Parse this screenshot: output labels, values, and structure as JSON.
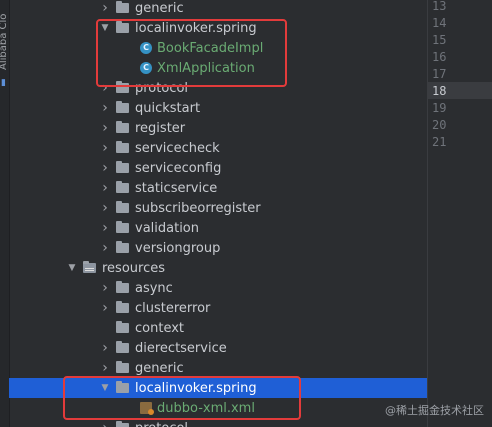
{
  "sidebar": {
    "tab_label": "Alibaba Clo",
    "icon": "pin-icon"
  },
  "gutter": {
    "lines": [
      "13",
      "14",
      "15",
      "16",
      "17",
      "18",
      "19",
      "20",
      "21"
    ],
    "current_line": "18"
  },
  "tree": {
    "rows": [
      {
        "label": "generic",
        "level": 1,
        "arrow": "collapsed",
        "type": "folder"
      },
      {
        "label": "localinvoker.spring",
        "level": 1,
        "arrow": "expanded",
        "type": "folder"
      },
      {
        "label": "BookFacadeImpl",
        "level": 2,
        "arrow": "",
        "type": "class"
      },
      {
        "label": "XmlApplication",
        "level": 2,
        "arrow": "",
        "type": "class"
      },
      {
        "label": "protocol",
        "level": 1,
        "arrow": "collapsed",
        "type": "folder"
      },
      {
        "label": "quickstart",
        "level": 1,
        "arrow": "collapsed",
        "type": "folder"
      },
      {
        "label": "register",
        "level": 1,
        "arrow": "collapsed",
        "type": "folder"
      },
      {
        "label": "servicecheck",
        "level": 1,
        "arrow": "collapsed",
        "type": "folder"
      },
      {
        "label": "serviceconfig",
        "level": 1,
        "arrow": "collapsed",
        "type": "folder"
      },
      {
        "label": "staticservice",
        "level": 1,
        "arrow": "collapsed",
        "type": "folder"
      },
      {
        "label": "subscribeorregister",
        "level": 1,
        "arrow": "collapsed",
        "type": "folder"
      },
      {
        "label": "validation",
        "level": 1,
        "arrow": "collapsed",
        "type": "folder"
      },
      {
        "label": "versiongroup",
        "level": 1,
        "arrow": "collapsed",
        "type": "folder"
      },
      {
        "label": "resources",
        "level": 0,
        "arrow": "expanded",
        "type": "resfolder"
      },
      {
        "label": "async",
        "level": 1,
        "arrow": "collapsed",
        "type": "folder"
      },
      {
        "label": "clustererror",
        "level": 1,
        "arrow": "collapsed",
        "type": "folder"
      },
      {
        "label": "context",
        "level": 1,
        "arrow": "",
        "type": "folder"
      },
      {
        "label": "dierectservice",
        "level": 1,
        "arrow": "collapsed",
        "type": "folder"
      },
      {
        "label": "generic",
        "level": 1,
        "arrow": "collapsed",
        "type": "folder"
      },
      {
        "label": "localinvoker.spring",
        "level": 1,
        "arrow": "expanded",
        "type": "folder",
        "selected": true
      },
      {
        "label": "dubbo-xml.xml",
        "level": 2,
        "arrow": "",
        "type": "xml"
      },
      {
        "label": "protocol",
        "level": 1,
        "arrow": "collapsed",
        "type": "folder"
      }
    ]
  },
  "class_icon_letter": "C",
  "watermark": "@稀土掘金技术社区",
  "colors": {
    "selection": "#1f5fd6",
    "highlight_box": "#e23b3b",
    "green_text": "#6aab73"
  }
}
